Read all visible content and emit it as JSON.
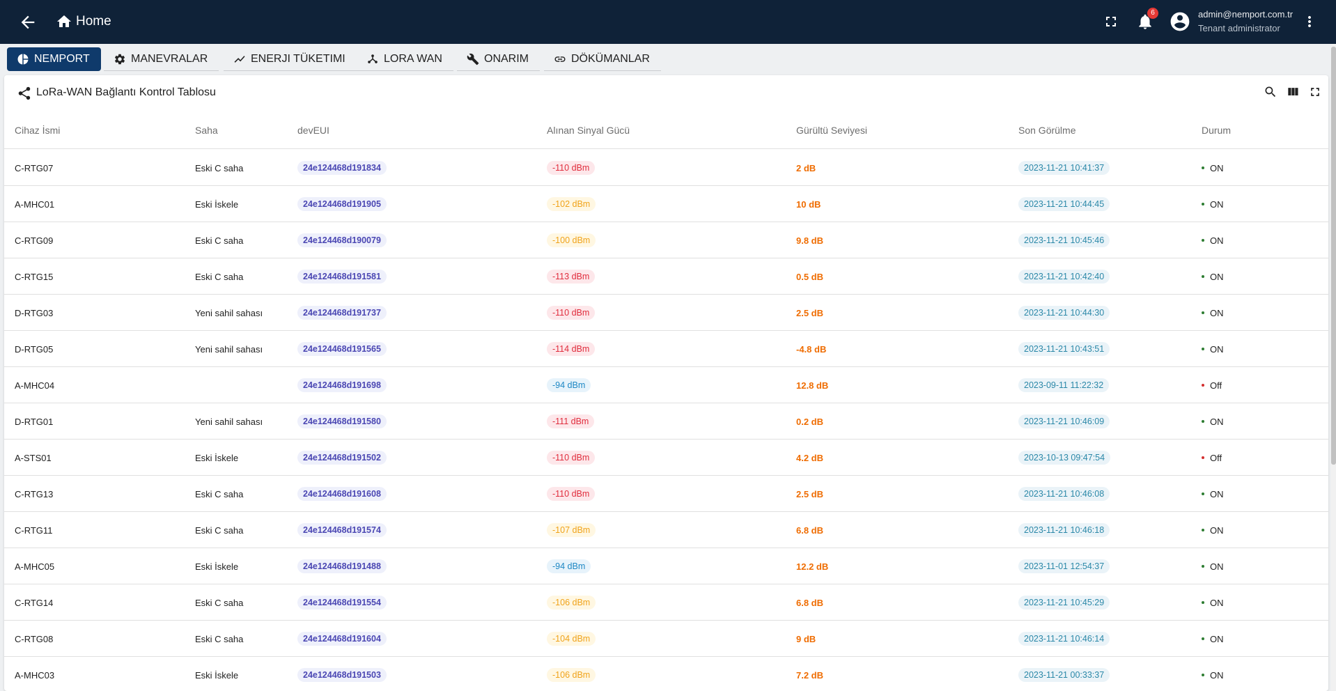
{
  "topbar": {
    "home_label": "Home",
    "notification_count": "6",
    "user_email": "admin@nemport.com.tr",
    "user_role": "Tenant administrator"
  },
  "tabs": [
    {
      "label": "NEMPORT",
      "icon": "pie-chart-icon",
      "active": true
    },
    {
      "label": "MANEVRALAR",
      "icon": "gear-icon",
      "active": false
    },
    {
      "label": "ENERJI TÜKETIMI",
      "icon": "trending-icon",
      "active": false
    },
    {
      "label": "LORA WAN",
      "icon": "hub-icon",
      "active": false
    },
    {
      "label": "ONARIM",
      "icon": "wrench-icon",
      "active": false
    },
    {
      "label": "DÖKÜMANLAR",
      "icon": "link-icon",
      "active": false
    }
  ],
  "card": {
    "title": "LoRa-WAN Bağlantı Kontrol Tablosu"
  },
  "table": {
    "headers": [
      "Cihaz İsmi",
      "Saha",
      "devEUI",
      "Alınan Sinyal Gücü",
      "Gürültü Seviyesi",
      "Son Görülme",
      "Durum"
    ],
    "rows": [
      {
        "name": "C-RTG07",
        "site": "Eski C saha",
        "eui": "24e124468d191834",
        "rssi": "-110 dBm",
        "rssi_level": "red",
        "noise": "2 dB",
        "last_seen": "2023-11-21 10:41:37",
        "status": "ON"
      },
      {
        "name": "A-MHC01",
        "site": "Eski İskele",
        "eui": "24e124468d191905",
        "rssi": "-102 dBm",
        "rssi_level": "yellow",
        "noise": "10 dB",
        "last_seen": "2023-11-21 10:44:45",
        "status": "ON"
      },
      {
        "name": "C-RTG09",
        "site": "Eski C saha",
        "eui": "24e124468d190079",
        "rssi": "-100 dBm",
        "rssi_level": "yellow",
        "noise": "9.8 dB",
        "last_seen": "2023-11-21 10:45:46",
        "status": "ON"
      },
      {
        "name": "C-RTG15",
        "site": "Eski C saha",
        "eui": "24e124468d191581",
        "rssi": "-113 dBm",
        "rssi_level": "red",
        "noise": "0.5 dB",
        "last_seen": "2023-11-21 10:42:40",
        "status": "ON"
      },
      {
        "name": "D-RTG03",
        "site": "Yeni sahil sahası",
        "eui": "24e124468d191737",
        "rssi": "-110 dBm",
        "rssi_level": "red",
        "noise": "2.5 dB",
        "last_seen": "2023-11-21 10:44:30",
        "status": "ON"
      },
      {
        "name": "D-RTG05",
        "site": "Yeni sahil sahası",
        "eui": "24e124468d191565",
        "rssi": "-114 dBm",
        "rssi_level": "red",
        "noise": "-4.8 dB",
        "last_seen": "2023-11-21 10:43:51",
        "status": "ON"
      },
      {
        "name": "A-MHC04",
        "site": "",
        "eui": "24e124468d191698",
        "rssi": "-94 dBm",
        "rssi_level": "blue",
        "noise": "12.8 dB",
        "last_seen": "2023-09-11 11:22:32",
        "status": "Off"
      },
      {
        "name": "D-RTG01",
        "site": "Yeni sahil sahası",
        "eui": "24e124468d191580",
        "rssi": "-111 dBm",
        "rssi_level": "red",
        "noise": "0.2 dB",
        "last_seen": "2023-11-21 10:46:09",
        "status": "ON"
      },
      {
        "name": "A-STS01",
        "site": "Eski İskele",
        "eui": "24e124468d191502",
        "rssi": "-110 dBm",
        "rssi_level": "red",
        "noise": "4.2 dB",
        "last_seen": "2023-10-13 09:47:54",
        "status": "Off"
      },
      {
        "name": "C-RTG13",
        "site": "Eski C saha",
        "eui": "24e124468d191608",
        "rssi": "-110 dBm",
        "rssi_level": "red",
        "noise": "2.5 dB",
        "last_seen": "2023-11-21 10:46:08",
        "status": "ON"
      },
      {
        "name": "C-RTG11",
        "site": "Eski C saha",
        "eui": "24e124468d191574",
        "rssi": "-107 dBm",
        "rssi_level": "yellow",
        "noise": "6.8 dB",
        "last_seen": "2023-11-21 10:46:18",
        "status": "ON"
      },
      {
        "name": "A-MHC05",
        "site": "Eski İskele",
        "eui": "24e124468d191488",
        "rssi": "-94 dBm",
        "rssi_level": "blue",
        "noise": "12.2 dB",
        "last_seen": "2023-11-01 12:54:37",
        "status": "ON"
      },
      {
        "name": "C-RTG14",
        "site": "Eski C saha",
        "eui": "24e124468d191554",
        "rssi": "-106 dBm",
        "rssi_level": "yellow",
        "noise": "6.8 dB",
        "last_seen": "2023-11-21 10:45:29",
        "status": "ON"
      },
      {
        "name": "C-RTG08",
        "site": "Eski C saha",
        "eui": "24e124468d191604",
        "rssi": "-104 dBm",
        "rssi_level": "yellow",
        "noise": "9 dB",
        "last_seen": "2023-11-21 10:46:14",
        "status": "ON"
      },
      {
        "name": "A-MHC03",
        "site": "Eski İskele",
        "eui": "24e124468d191503",
        "rssi": "-106 dBm",
        "rssi_level": "yellow",
        "noise": "7.2 dB",
        "last_seen": "2023-11-21 00:33:37",
        "status": "ON"
      }
    ]
  },
  "colors": {
    "topbar": "#0f2238",
    "active_tab": "#0f3a6b",
    "rssi_red": "#e02c3c",
    "rssi_yellow": "#f0a31a",
    "rssi_blue": "#1d87c4",
    "noise": "#ef6c00",
    "status_on": "#2e7d32",
    "status_off": "#d32f2f"
  }
}
